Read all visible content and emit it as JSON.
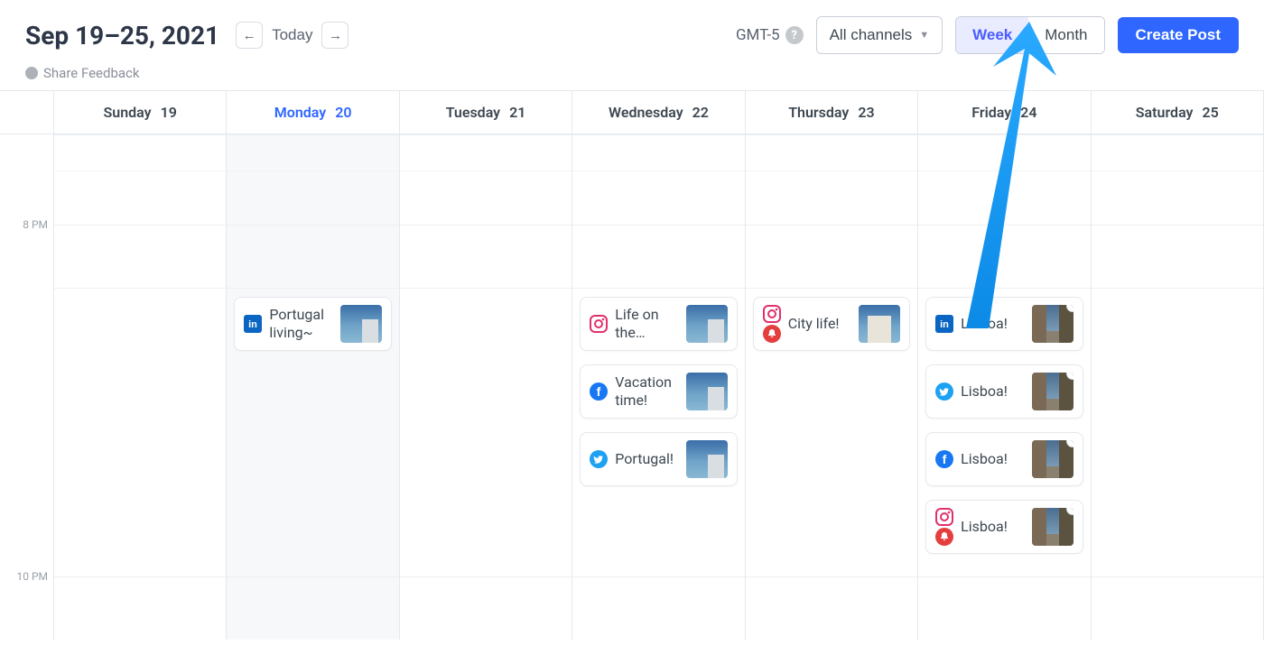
{
  "header": {
    "title": "Sep 19–25, 2021",
    "today_label": "Today",
    "timezone": "GMT-5",
    "channels_label": "All channels",
    "view_week": "Week",
    "view_month": "Month",
    "create_label": "Create Post"
  },
  "feedback_label": "Share Feedback",
  "days": [
    {
      "name": "Sunday",
      "num": "19",
      "today": false
    },
    {
      "name": "Monday",
      "num": "20",
      "today": true
    },
    {
      "name": "Tuesday",
      "num": "21",
      "today": false
    },
    {
      "name": "Wednesday",
      "num": "22",
      "today": false
    },
    {
      "name": "Thursday",
      "num": "23",
      "today": false
    },
    {
      "name": "Friday",
      "num": "24",
      "today": false
    },
    {
      "name": "Saturday",
      "num": "25",
      "today": false
    }
  ],
  "time_labels": {
    "t8": "8 PM",
    "t10": "10 PM"
  },
  "posts": {
    "mon_0": "Portugal living~",
    "wed_0": "Life on the…",
    "wed_1": "Vacation time!",
    "wed_2": "Portugal!",
    "thu_0": "City life!",
    "fri_0": "Lisboa!",
    "fri_1": "Lisboa!",
    "fri_2": "Lisboa!",
    "fri_3": "Lisboa!"
  },
  "colors": {
    "primary": "#2e66ff",
    "linkedin": "#0a66c2",
    "facebook": "#1877f2",
    "twitter": "#1da1f2",
    "instagram": "#e1306c",
    "bell": "#e53e3e"
  }
}
